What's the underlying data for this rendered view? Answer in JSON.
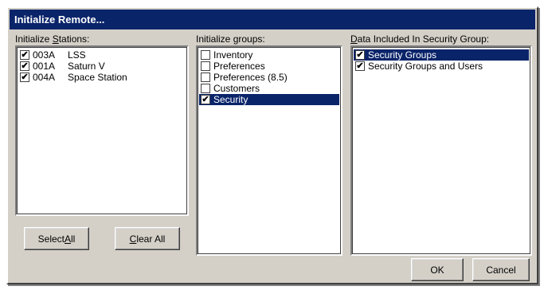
{
  "window": {
    "title": "Initialize Remote..."
  },
  "stations": {
    "label_prefix": "Initialize ",
    "label_accel": "S",
    "label_rest": "tations:",
    "items": [
      {
        "code": "003A",
        "name": "LSS",
        "checked": true
      },
      {
        "code": "001A",
        "name": "Saturn V",
        "checked": true
      },
      {
        "code": "004A",
        "name": "Space Station",
        "checked": true
      }
    ],
    "select_all": {
      "prefix": "Select ",
      "accel": "A",
      "rest": "ll"
    },
    "clear_all": {
      "prefix": "",
      "accel": "C",
      "rest": "lear All"
    }
  },
  "groups": {
    "label_prefix": "Initialize ",
    "label_accel": "g",
    "label_rest": "roups:",
    "items": [
      {
        "label": "Inventory",
        "checked": false
      },
      {
        "label": "Preferences",
        "checked": false
      },
      {
        "label": "Preferences (8.5)",
        "checked": false
      },
      {
        "label": "Customers",
        "checked": false
      },
      {
        "label": "Security",
        "checked": true,
        "selected": true
      }
    ]
  },
  "security_data": {
    "label_prefix": "",
    "label_accel": "D",
    "label_rest": "ata Included In Security Group:",
    "items": [
      {
        "label": "Security Groups",
        "checked": true,
        "selected": true
      },
      {
        "label": "Security Groups and Users",
        "checked": true
      }
    ]
  },
  "buttons": {
    "ok": "OK",
    "cancel": "Cancel"
  },
  "colors": {
    "face": "#d4d0c8",
    "selection": "#0a246a",
    "title_bar": "#0a246a"
  },
  "icons": {
    "checkmark": "✔"
  }
}
